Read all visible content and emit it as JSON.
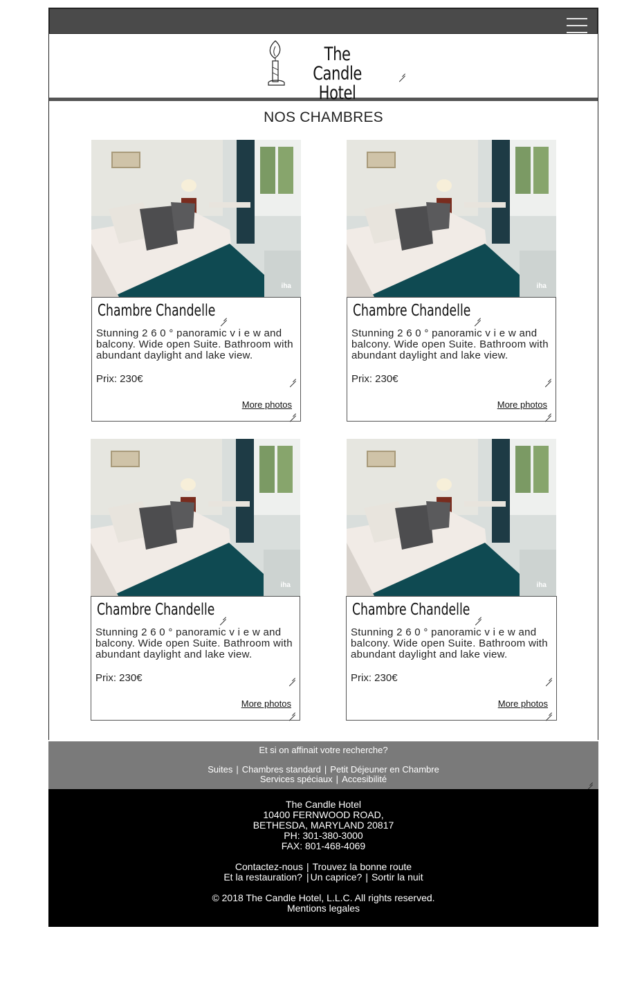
{
  "header": {
    "logo_line1": "The Candle",
    "logo_line2": "Hotel"
  },
  "main": {
    "section_title": "NOS CHAMBRES",
    "rooms": [
      {
        "name": "Chambre Chandelle",
        "desc": "Stunning 2 6 0 ° panoramic v i e w and balcony. Wide open Suite. Bathroom with abundant daylight and lake view.",
        "price": "Prix: 230€",
        "more": "More photos"
      },
      {
        "name": "Chambre Chandelle",
        "desc": "Stunning 2 6 0 ° panoramic v i e w and balcony. Wide open Suite. Bathroom with abundant daylight and lake view.",
        "price": "Prix: 230€",
        "more": "More photos"
      },
      {
        "name": "Chambre Chandelle",
        "desc": "Stunning 2 6 0 ° panoramic v i e w and balcony. Wide open Suite. Bathroom with abundant daylight and lake view.",
        "price": "Prix: 230€",
        "more": "More photos"
      },
      {
        "name": "Chambre Chandelle",
        "desc": "Stunning 2 6 0 ° panoramic v i e w and balcony. Wide open Suite. Bathroom with abundant daylight and lake view.",
        "price": "Prix: 230€",
        "more": "More photos"
      }
    ],
    "photo_watermark": "iha"
  },
  "filter": {
    "question": "Et si on affinait votre recherche?",
    "links_row1": [
      "Suites",
      "Chambres standard",
      "Petit Déjeuner en Chambre"
    ],
    "links_row2": [
      "Services spéciaux",
      "Accesibilité"
    ]
  },
  "footer": {
    "name": "The Candle Hotel",
    "street": "10400 FERNWOOD ROAD,",
    "city": "BETHESDA, MARYLAND 20817",
    "phone": "PH: 301-380-3000",
    "fax": "FAX: 801-468-4069",
    "links_row1": [
      "Contactez-nous",
      "Trouvez la bonne route"
    ],
    "links_row2": [
      "Et la restauration?",
      "Un caprice?",
      "Sortir la nuit"
    ],
    "copyright": "© 2018 The Candle Hotel, L.L.C. All rights reserved.",
    "legal": "Mentions legales"
  },
  "colors": {
    "topbar": "#4a4a4a",
    "filter_bar": "#7a7a7a",
    "footer": "#000000"
  }
}
